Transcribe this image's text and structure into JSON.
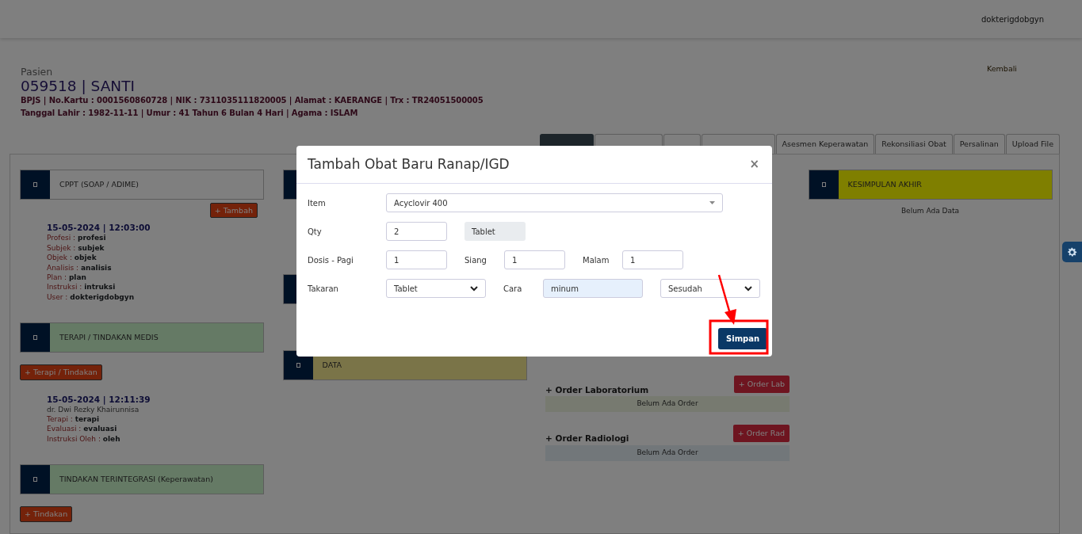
{
  "navbar": {
    "user": "dokterigdobgyn"
  },
  "patient": {
    "label": "Pasien",
    "title": "059518 | SANTI",
    "info_lines": [
      "BPJS | No.Kartu : 0001560860728 | NIK : 7311035111820005 | Alamat : KAERANGE | Trx : TR24051500005",
      "Tanggal Lahir : 1982-11-11 | Umur : 41 Tahun 6 Bulan 4 Hari | Agama : ISLAM"
    ],
    "back_link": "Kembali"
  },
  "tabs": [
    {
      "selected": true
    },
    {
      "selected": false
    },
    {
      "selected": false
    },
    {
      "selected": false
    },
    {
      "label": "Asesmen Keperawatan",
      "selected": false
    },
    {
      "label": "Rekonsiliasi Obat",
      "selected": false
    },
    {
      "label": "Persalinan",
      "selected": false
    },
    {
      "label": "Upload File",
      "selected": false
    }
  ],
  "columns": [
    {
      "sections": [
        {
          "kind": "header",
          "title": "CPPT (SOAP / ADIME)"
        },
        {
          "kind": "button",
          "label": "+ Tambah"
        },
        {
          "kind": "entry",
          "timestamp": "15-05-2024 | 12:03:00",
          "fields": [
            {
              "label": "Profesi :",
              "value": "profesi"
            },
            {
              "label": "Subjek :",
              "value": "subjek"
            },
            {
              "label": "Objek :",
              "value": "objek"
            },
            {
              "label": "Analisis :",
              "value": "analisis"
            },
            {
              "label": "Plan :",
              "value": "plan"
            },
            {
              "label": "Instruksi :",
              "value": "intruksi"
            },
            {
              "label": "User :",
              "value": "dokterigdobgyn"
            }
          ]
        },
        {
          "kind": "header",
          "title": "TERAPI / TINDAKAN MEDIS"
        },
        {
          "kind": "button",
          "label": "+ Terapi / Tindakan"
        },
        {
          "kind": "entry",
          "timestamp": "15-05-2024 | 12:11:39",
          "author": "dr. Dwi Rezky Khairunnisa",
          "fields": [
            {
              "label": "Terapi :",
              "value": "terapi"
            },
            {
              "label": "Evaluasi :",
              "value": "evaluasi"
            },
            {
              "label": "Instruksi Oleh :",
              "value": "oleh"
            }
          ]
        },
        {
          "kind": "header",
          "title": "TINDAKAN TERINTEGRASI (Keperawatan)"
        },
        {
          "kind": "button",
          "label": "+ Tindakan"
        }
      ]
    },
    {
      "sections": [
        {
          "kind": "header"
        },
        {
          "kind": "header"
        },
        {
          "kind": "header",
          "title": "DATA"
        }
      ]
    },
    {
      "sections": [
        {
          "kind": "order",
          "title": "+ Order Laboratorium",
          "button": "+ Order Lab",
          "empty_text": "Belum Ada Order"
        },
        {
          "kind": "order",
          "title": "+ Order Radiologi",
          "button": "+ Order Rad",
          "empty_text": "Belum Ada Order"
        }
      ]
    },
    {
      "sections": [
        {
          "kind": "header",
          "title": "KESIMPULAN AKHIR"
        },
        {
          "kind": "note",
          "text": "Belum Ada Data"
        }
      ]
    }
  ],
  "modal": {
    "title": "Tambah Obat Baru Ranap/IGD",
    "close": "×",
    "rows": [
      {
        "fields": [
          {
            "label": "Item",
            "kind": "combo",
            "value": "Acyclovir 400"
          }
        ]
      },
      {
        "fields": [
          {
            "label": "Qty",
            "kind": "input",
            "value": "2"
          },
          {
            "kind": "readonly",
            "value": "Tablet"
          }
        ]
      },
      {
        "fields": [
          {
            "label": "Dosis - Pagi",
            "kind": "input",
            "value": "1"
          },
          {
            "label": "Siang",
            "kind": "input",
            "value": "1"
          },
          {
            "label": "Malam",
            "kind": "input",
            "value": "1"
          }
        ]
      },
      {
        "fields": [
          {
            "label": "Takaran",
            "kind": "select",
            "value": "Tablet"
          },
          {
            "label": "Cara",
            "kind": "filled",
            "value": "minum"
          },
          {
            "kind": "select",
            "value": "Sesudah"
          }
        ]
      }
    ],
    "submit": "Simpan"
  }
}
